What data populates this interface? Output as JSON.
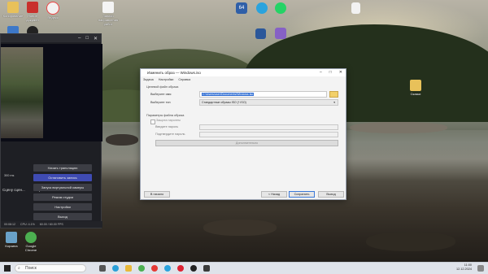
{
  "desktop": {
    "icons": [
      {
        "label": "Копирование"
      },
      {
        "label": "Новое\nдокумен"
      },
      {
        "label": "Яндекс"
      },
      {
        "label": "Записи\nнаправления\nработ"
      },
      {
        "label": "Windows\nISO"
      },
      {
        "label": "Папки"
      },
      {
        "label": "Camera"
      },
      {
        "label": "HWiNFO"
      },
      {
        "label": "Telegram"
      },
      {
        "label": "WhatsApp"
      },
      {
        "label": "Word"
      },
      {
        "label": "Outlook"
      },
      {
        "label": "Visual\nStudio"
      },
      {
        "label": "Сказки"
      },
      {
        "label": "Корзина"
      },
      {
        "label": "Google\nChrome"
      }
    ]
  },
  "obs": {
    "scene_panel_label": "Сцену сцен...",
    "controls_label": "Управление",
    "buttons": [
      "Начать трансляцию",
      "Остановить запись",
      "Запуск виртуальной камеры",
      "Режим студии",
      "Настройки",
      "Выход"
    ],
    "level_label": "300 ms",
    "status": [
      "00:08:12",
      "CPU: 4.1%",
      "60.00 / 60.00 FPS"
    ]
  },
  "dialog": {
    "title": "Изменить образ — Windows.iso",
    "menu": [
      "Задача",
      "Настройки",
      "Справка"
    ],
    "target_group": "Целевой файл образа",
    "file_label": "Выберите имя",
    "file_value": "C:\\Users\\user\\Documents\\Windows.iso",
    "type_label": "Выберите тип",
    "type_value": "Стандартные образы ISO (*.ISO)",
    "params_group": "Параметры файла образа",
    "protect_label": "Защита паролем",
    "password_label": "Введите пароль",
    "confirm_label": "Подтвердите пароль",
    "extra_button": "Дополнительно",
    "btn_start": "В начало",
    "btn_back": "< Назад",
    "btn_save": "Сохранить",
    "btn_exit": "Выход"
  },
  "taskbar": {
    "search_placeholder": "Поиск",
    "time": "11:00",
    "date": "12.12.2024"
  }
}
